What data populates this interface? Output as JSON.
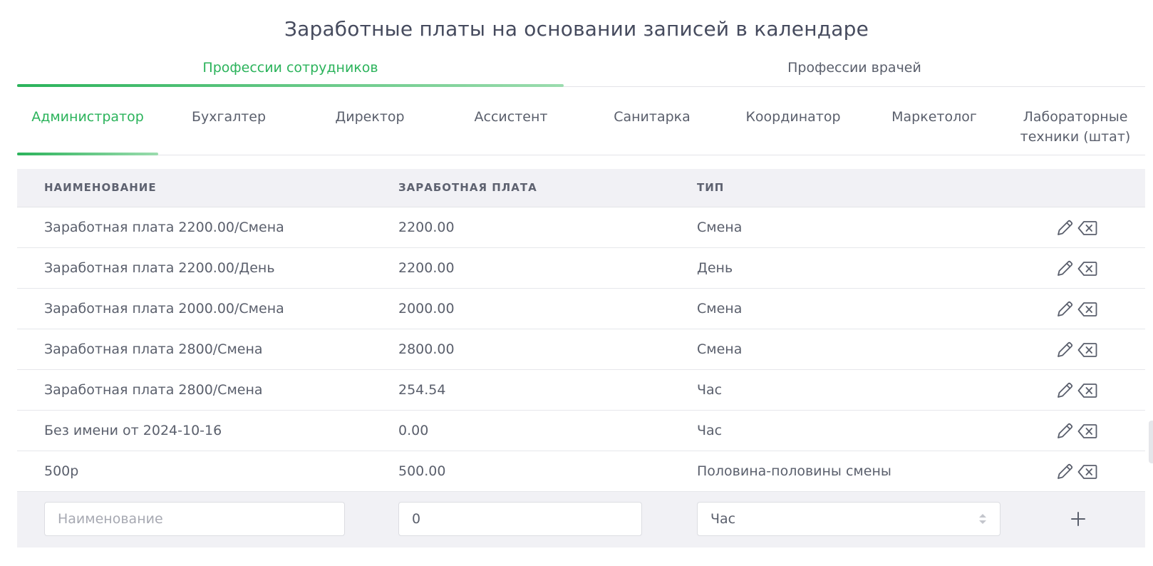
{
  "page_title": "Заработные платы на основании записей в календаре",
  "main_tabs": [
    {
      "label": "Профессии сотрудников",
      "active": true
    },
    {
      "label": "Профессии врачей",
      "active": false
    }
  ],
  "profession_tabs": [
    {
      "label": "Администратор",
      "active": true
    },
    {
      "label": "Бухгалтер"
    },
    {
      "label": "Директор"
    },
    {
      "label": "Ассистент"
    },
    {
      "label": "Санитарка"
    },
    {
      "label": "Координатор"
    },
    {
      "label": "Маркетолог"
    },
    {
      "label": "Лабораторные техники (штат)"
    }
  ],
  "table": {
    "headers": {
      "name": "НАИМЕНОВАНИЕ",
      "salary": "ЗАРАБОТНАЯ ПЛАТА",
      "type": "ТИП"
    },
    "rows": [
      {
        "name": "Заработная плата 2200.00/Смена",
        "salary": "2200.00",
        "type": "Смена"
      },
      {
        "name": "Заработная плата 2200.00/День",
        "salary": "2200.00",
        "type": "День"
      },
      {
        "name": "Заработная плата 2000.00/Смена",
        "salary": "2000.00",
        "type": "Смена"
      },
      {
        "name": "Заработная плата 2800/Смена",
        "salary": "2800.00",
        "type": "Смена"
      },
      {
        "name": "Заработная плата 2800/Смена",
        "salary": "254.54",
        "type": "Час"
      },
      {
        "name": "Без имени от 2024-10-16",
        "salary": "0.00",
        "type": "Час"
      },
      {
        "name": "500р",
        "salary": "500.00",
        "type": "Половина-половины смены"
      }
    ]
  },
  "add_form": {
    "name_placeholder": "Наименование",
    "salary_value": "0",
    "type_value": "Час"
  },
  "icons": {
    "edit": "pencil-icon",
    "delete": "backspace-delete-icon",
    "add": "plus-icon",
    "select": "sort-arrows-icon"
  },
  "colors": {
    "accent": "#2bb35b",
    "header_bg": "#f1f1f5",
    "text": "#5a5f6c"
  }
}
